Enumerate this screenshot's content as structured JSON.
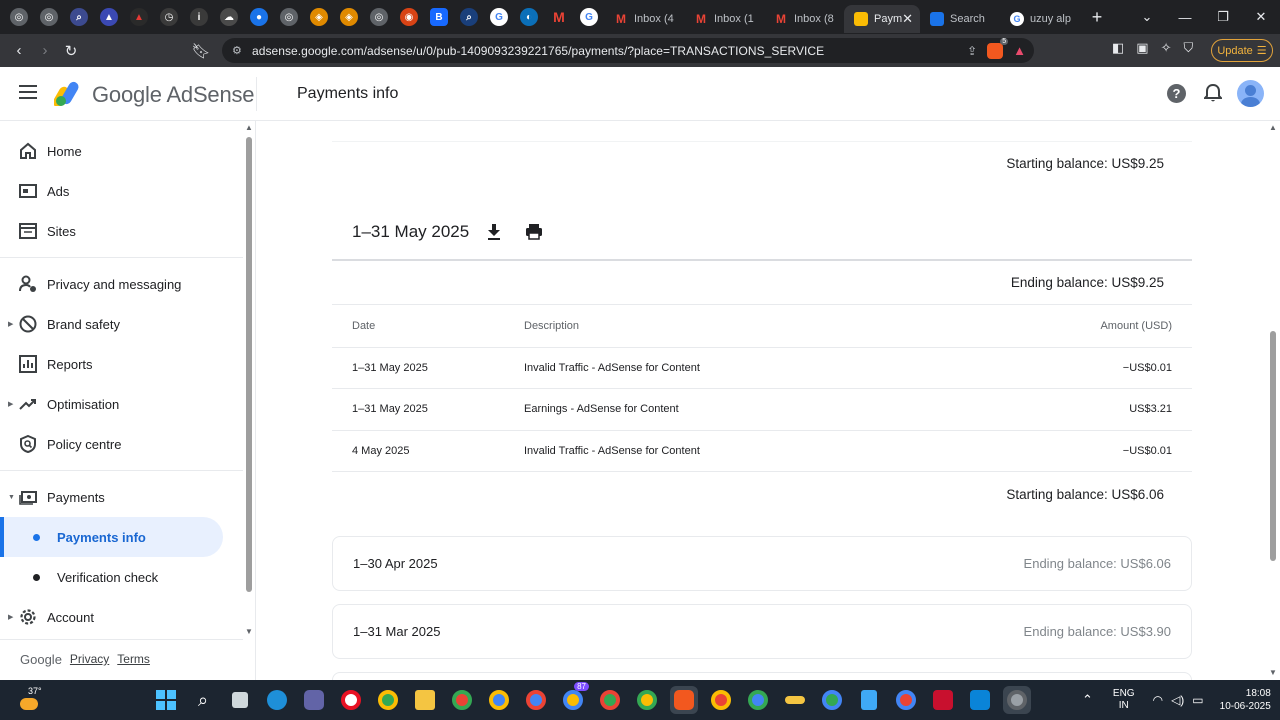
{
  "browser": {
    "tabs": [
      {
        "label": "Inbox (4",
        "icon": "gmail-icon"
      },
      {
        "label": "Inbox (1",
        "icon": "gmail-icon"
      },
      {
        "label": "Inbox (8",
        "icon": "gmail-icon"
      },
      {
        "label": "Paym",
        "icon": "adsense-icon",
        "active": true
      },
      {
        "label": "Search",
        "icon": "search-console-icon"
      },
      {
        "label": "uzuy alp",
        "icon": "google-icon"
      }
    ],
    "url": "adsense.google.com/adsense/u/0/pub-1409093239221765/payments/?place=TRANSACTIONS_SERVICE",
    "update_label": "Update",
    "brave_badge": "5"
  },
  "header": {
    "brand": "Google AdSense",
    "page_title": "Payments info"
  },
  "sidebar": {
    "items": [
      {
        "label": "Home"
      },
      {
        "label": "Ads"
      },
      {
        "label": "Sites"
      },
      {
        "label": "Privacy and messaging"
      },
      {
        "label": "Brand safety"
      },
      {
        "label": "Reports"
      },
      {
        "label": "Optimisation"
      },
      {
        "label": "Policy centre"
      },
      {
        "label": "Payments"
      },
      {
        "label": "Payments info"
      },
      {
        "label": "Verification check"
      },
      {
        "label": "Account"
      }
    ],
    "footer": {
      "google": "Google",
      "privacy": "Privacy",
      "terms": "Terms"
    }
  },
  "main": {
    "top_starting_balance": "Starting balance: US$9.25",
    "period_title": "1–31 May 2025",
    "ending_balance": "Ending balance: US$9.25",
    "columns": {
      "date": "Date",
      "description": "Description",
      "amount": "Amount (USD)"
    },
    "rows": [
      {
        "date": "1–31 May 2025",
        "description": "Invalid Traffic - AdSense for Content",
        "amount": "−US$0.01"
      },
      {
        "date": "1–31 May 2025",
        "description": "Earnings - AdSense for Content",
        "amount": "US$3.21"
      },
      {
        "date": "4 May 2025",
        "description": "Invalid Traffic - AdSense for Content",
        "amount": "−US$0.01"
      }
    ],
    "starting_balance": "Starting balance: US$6.06",
    "collapsed": [
      {
        "period": "1–30 Apr 2025",
        "balance": "Ending balance: US$6.06"
      },
      {
        "period": "1–31 Mar 2025",
        "balance": "Ending balance: US$3.90"
      }
    ]
  },
  "taskbar": {
    "temperature": "37°",
    "lang_1": "ENG",
    "lang_2": "IN",
    "time": "18:08",
    "date": "10-06-2025",
    "badge_count": "87"
  },
  "colors": {
    "accent": "#1a73e8",
    "active_bg": "#e8f0fe",
    "update_border": "#e2a33a"
  }
}
